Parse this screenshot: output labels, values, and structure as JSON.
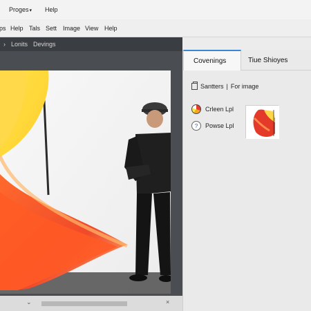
{
  "titlebar": {
    "items": [
      {
        "label": "Proges"
      },
      {
        "label": "Help"
      }
    ]
  },
  "menubar": {
    "items": [
      {
        "label": "ps"
      },
      {
        "label": "Help"
      },
      {
        "label": "Tals"
      },
      {
        "label": "Sett"
      },
      {
        "label": "Image"
      },
      {
        "label": "View"
      },
      {
        "label": "Help"
      }
    ]
  },
  "breadcrumb": {
    "chevron": "›",
    "items": [
      {
        "label": "Lonits"
      },
      {
        "label": "Devings"
      }
    ]
  },
  "panel": {
    "tabs": [
      {
        "label": "Covenings",
        "active": true
      },
      {
        "label": "Tiue Shioyes",
        "active": false
      }
    ],
    "section": {
      "prefix": "Santters",
      "divider": "|",
      "label": "For image"
    },
    "options": [
      {
        "label": "Crleen Lpl",
        "icon": "color-wheel-icon"
      },
      {
        "label": "Powse Lpl",
        "icon": "help-icon",
        "glyph": "?"
      }
    ]
  },
  "colors": {
    "accent": "#3c86d6",
    "dark_bar": "#3a3d42",
    "canvas": "#4a4d52"
  }
}
